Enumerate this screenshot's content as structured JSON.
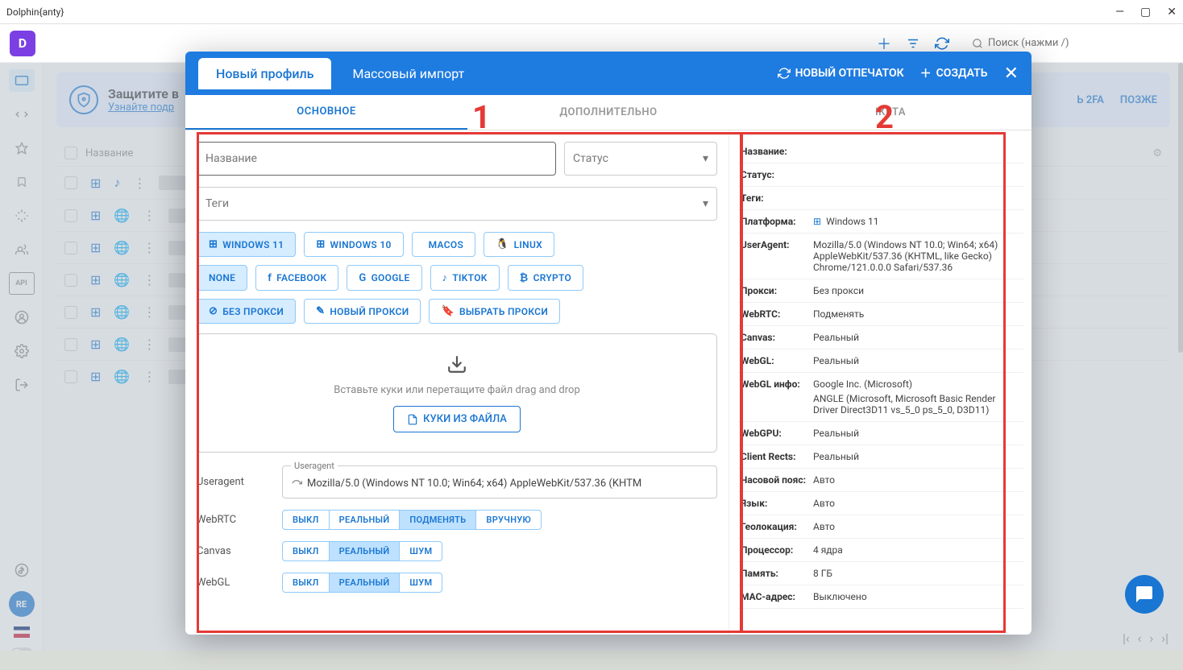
{
  "window": {
    "title": "Dolphin{anty}"
  },
  "toolbar": {
    "search_placeholder": "Поиск (нажми /)"
  },
  "banner": {
    "title": "Защитите в",
    "link": "Узнайте подр",
    "btn1": "Ь 2FA",
    "btn2": "ПОЗЖЕ"
  },
  "table": {
    "header_name": "Название"
  },
  "sidebar": {
    "avatar": "RE"
  },
  "modal": {
    "tabs": {
      "new_profile": "Новый профиль",
      "mass_import": "Массовый импорт"
    },
    "header_actions": {
      "new_fingerprint": "НОВЫЙ ОТПЕЧАТОК",
      "create": "СОЗДАТЬ"
    },
    "subtabs": {
      "main": "ОСНОВНОЕ",
      "advanced": "ДОПОЛНИТЕЛЬНО",
      "summary": "ІКЕТА"
    },
    "form": {
      "name_placeholder": "Название",
      "status_placeholder": "Статус",
      "tags_placeholder": "Теги",
      "os": {
        "win11": "WINDOWS 11",
        "win10": "WINDOWS 10",
        "macos": "MACOS",
        "linux": "LINUX"
      },
      "site": {
        "none": "NONE",
        "facebook": "FACEBOOK",
        "google": "GOOGLE",
        "tiktok": "TIKTOK",
        "crypto": "CRYPTO"
      },
      "proxy": {
        "no_proxy": "БЕЗ ПРОКСИ",
        "new_proxy": "НОВЫЙ ПРОКСИ",
        "select_proxy": "ВЫБРАТЬ ПРОКСИ"
      },
      "dropzone_text": "Вставьте куки или перетащите файл drag and drop",
      "cookies_file_btn": "КУКИ ИЗ ФАЙЛА",
      "ua_label": "Useragent",
      "ua_legend": "Useragent",
      "ua_value": "Mozilla/5.0 (Windows NT 10.0; Win64; x64) AppleWebKit/537.36 (KHTM",
      "webrtc_label": "WebRTC",
      "canvas_label": "Canvas",
      "webgl_label": "WebGL",
      "seg": {
        "off": "ВЫКЛ",
        "real": "РЕАЛЬНЫЙ",
        "replace": "ПОДМЕНЯТЬ",
        "manual": "ВРУЧНУЮ",
        "noise": "ШУМ"
      }
    }
  },
  "summary": {
    "name_k": "Название:",
    "name_v": "",
    "status_k": "Статус:",
    "status_v": "",
    "tags_k": "Теги:",
    "tags_v": "",
    "platform_k": "Платформа:",
    "platform_v": "Windows 11",
    "ua_k": "UserAgent:",
    "ua_v": "Mozilla/5.0 (Windows NT 10.0; Win64; x64) AppleWebKit/537.36 (KHTML, like Gecko) Chrome/121.0.0.0 Safari/537.36",
    "proxy_k": "Прокси:",
    "proxy_v": "Без прокси",
    "webrtc_k": "WebRTC:",
    "webrtc_v": "Подменять",
    "canvas_k": "Canvas:",
    "canvas_v": "Реальный",
    "webgl_k": "WebGL:",
    "webgl_v": "Реальный",
    "webglinfo_k": "WebGL инфо:",
    "webglinfo_v1": "Google Inc. (Microsoft)",
    "webglinfo_v2": "ANGLE (Microsoft, Microsoft Basic Render Driver Direct3D11 vs_5_0 ps_5_0, D3D11)",
    "webgpu_k": "WebGPU:",
    "webgpu_v": "Реальный",
    "rects_k": "Client Rects:",
    "rects_v": "Реальный",
    "tz_k": "Часовой пояс:",
    "tz_v": "Авто",
    "lang_k": "Язык:",
    "lang_v": "Авто",
    "geo_k": "Геолокация:",
    "geo_v": "Авто",
    "cpu_k": "Процессор:",
    "cpu_v": "4 ядра",
    "mem_k": "Память:",
    "mem_v": "8 ГБ",
    "mac_k": "MAC-адрес:",
    "mac_v": "Выключено"
  },
  "annotations": {
    "num1": "1",
    "num2": "2"
  }
}
